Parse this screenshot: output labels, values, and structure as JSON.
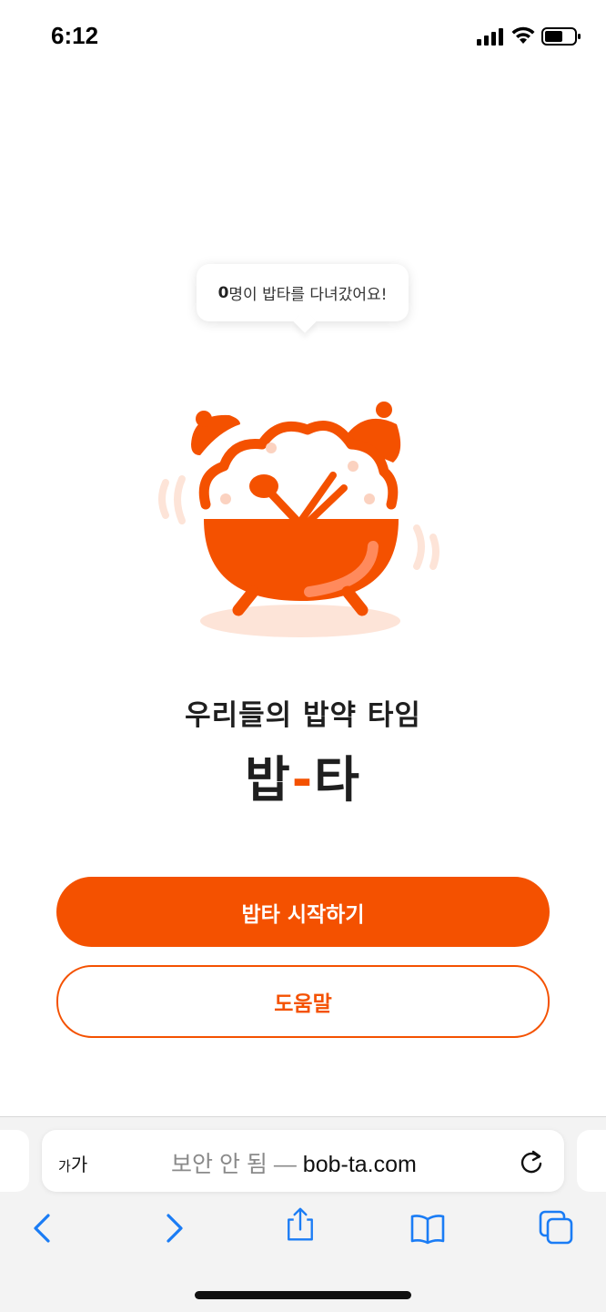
{
  "status_bar": {
    "time": "6:12"
  },
  "tooltip": {
    "count": "0",
    "text": "명이 밥타를 다녀갔어요!"
  },
  "mascot": {
    "icon": "rice-bowl-alarm-clock-icon"
  },
  "hero": {
    "tagline": "우리들의 밥약 타임",
    "title_part1": "밥",
    "title_dash": "-",
    "title_part2": "타"
  },
  "actions": {
    "start_label": "밥타 시작하기",
    "help_label": "도움말"
  },
  "browser": {
    "text_size_label_small": "가",
    "text_size_label_large": "가",
    "security_label": "보안 안 됨 — ",
    "domain": "bob-ta.com",
    "icons": {
      "reload": "reload-icon",
      "back": "chevron-left-icon",
      "forward": "chevron-right-icon",
      "share": "share-icon",
      "bookmarks": "book-icon",
      "tabs": "tabs-icon"
    }
  },
  "colors": {
    "accent": "#f45100",
    "accent_light": "#fde4d8",
    "ios_blue": "#1a7cf5",
    "text_dark": "#1f1f1f"
  }
}
